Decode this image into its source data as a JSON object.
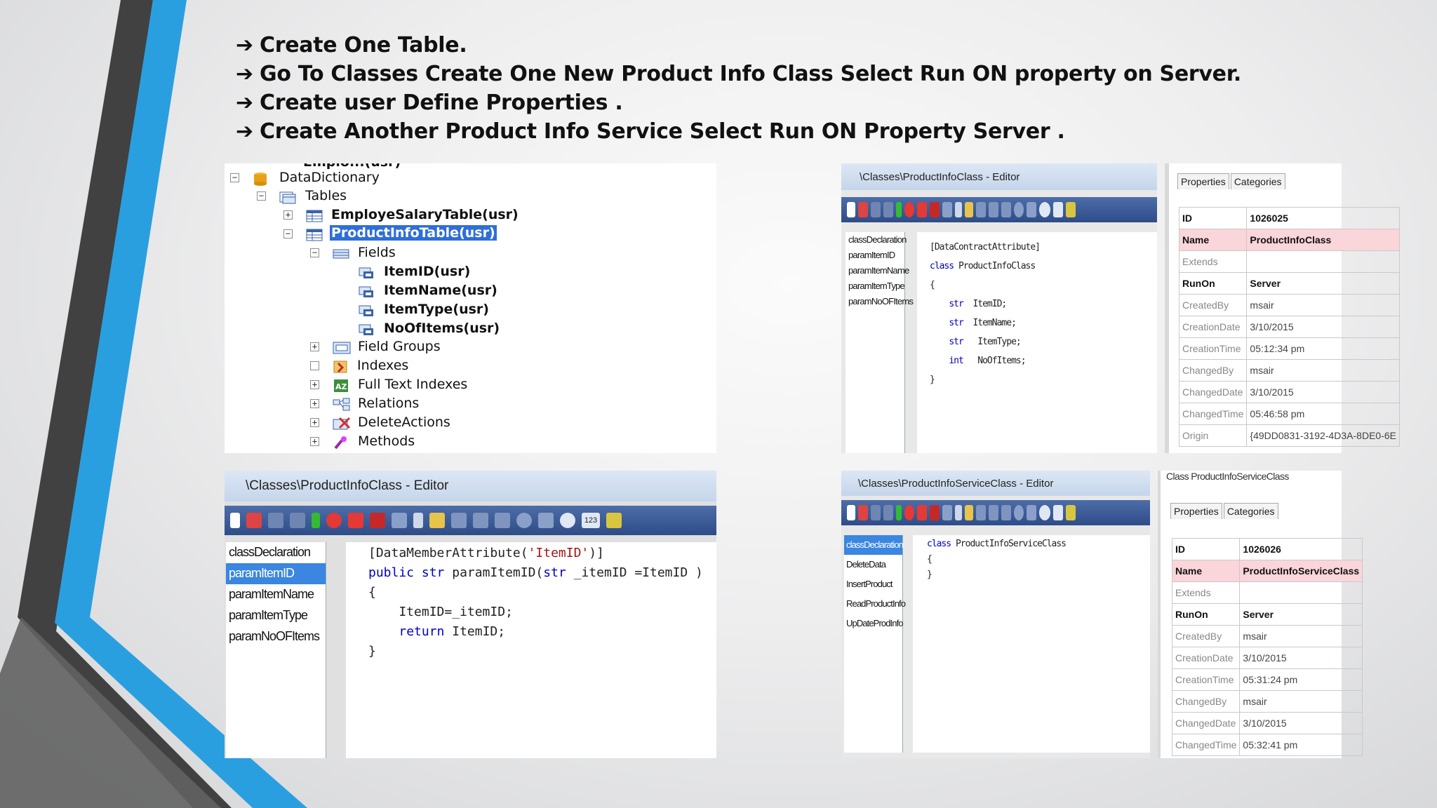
{
  "bullets": [
    "Create One Table.",
    "Go To Classes Create One New Product Info Class  Select Run ON  property on Server.",
    "Create user Define Properties .",
    "Create Another Product Info Service Select Run ON Property Server ."
  ],
  "bullet_arrow": "➔",
  "tree": {
    "partial_top": "Emplo...(usr)",
    "data_dictionary": "DataDictionary",
    "tables": "Tables",
    "employe_table": "EmployeSalaryTable(usr)",
    "product_table": "ProductInfoTable(usr)",
    "fields": "Fields",
    "field_items": [
      "ItemID(usr)",
      "ItemName(usr)",
      "ItemType(usr)",
      "NoOfItems(usr)"
    ],
    "field_groups": "Field Groups",
    "indexes": "Indexes",
    "full_text_indexes": "Full Text Indexes",
    "relations": "Relations",
    "delete_actions": "DeleteActions",
    "methods": "Methods"
  },
  "editor_top": {
    "title": "\\Classes\\ProductInfoClass - Editor",
    "methods": [
      "classDeclaration",
      "paramItemID",
      "paramItemName",
      "paramItemType",
      "paramNoOFItems"
    ],
    "code": [
      "[DataContractAttribute]",
      "class ProductInfoClass",
      "{",
      "    str  ItemID;",
      "    str  ItemName;",
      "    str   ItemType;",
      "    int   NoOfItems;",
      "",
      "",
      "}"
    ],
    "props_tabs": [
      "Properties",
      "Categories"
    ],
    "props": [
      [
        "ID",
        "1026025"
      ],
      [
        "Name",
        "ProductInfoClass"
      ],
      [
        "Extends",
        ""
      ],
      [
        "RunOn",
        "Server"
      ],
      [
        "CreatedBy",
        "msair"
      ],
      [
        "CreationDate",
        "3/10/2015"
      ],
      [
        "CreationTime",
        "05:12:34 pm"
      ],
      [
        "ChangedBy",
        "msair"
      ],
      [
        "ChangedDate",
        "3/10/2015"
      ],
      [
        "ChangedTime",
        "05:46:58 pm"
      ],
      [
        "Origin",
        "{49DD0831-3192-4D3A-8DE0-6E"
      ]
    ]
  },
  "editor_bottom": {
    "title": "\\Classes\\ProductInfoClass - Editor",
    "methods": [
      "classDeclaration",
      "paramItemID",
      "paramItemName",
      "paramItemType",
      "paramNoOFItems"
    ],
    "active_method": "paramItemID",
    "code": [
      "[DataMemberAttribute('ItemID')]",
      "public str paramItemID(str _itemID =ItemID )",
      "{",
      "    ItemID=_itemID;",
      "    return ItemID;",
      "}"
    ],
    "toolbar_badge": "123"
  },
  "editor_service": {
    "title": "\\Classes\\ProductInfoServiceClass - Editor",
    "methods": [
      "classDeclaration",
      "DeleteData",
      "InsertProduct",
      "ReadProductInfo",
      "UpDateProdInfo"
    ],
    "active_method": "classDeclaration",
    "code": [
      "class ProductInfoServiceClass",
      "{",
      "}"
    ],
    "props_header": "Class ProductInfoServiceClass",
    "props_tabs": [
      "Properties",
      "Categories"
    ],
    "props": [
      [
        "ID",
        "1026026"
      ],
      [
        "Name",
        "ProductInfoServiceClass"
      ],
      [
        "Extends",
        ""
      ],
      [
        "RunOn",
        "Server"
      ],
      [
        "CreatedBy",
        "msair"
      ],
      [
        "CreationDate",
        "3/10/2015"
      ],
      [
        "CreationTime",
        "05:31:24 pm"
      ],
      [
        "ChangedBy",
        "msair"
      ],
      [
        "ChangedDate",
        "3/10/2015"
      ],
      [
        "ChangedTime",
        "05:32:41 pm"
      ]
    ]
  },
  "colors": {
    "deco_blue": "#2a9fe0",
    "deco_dark": "#3f3f3f",
    "selection": "#2f6ed8",
    "name_row": "#fad5da",
    "toolbar": "#35558f"
  }
}
